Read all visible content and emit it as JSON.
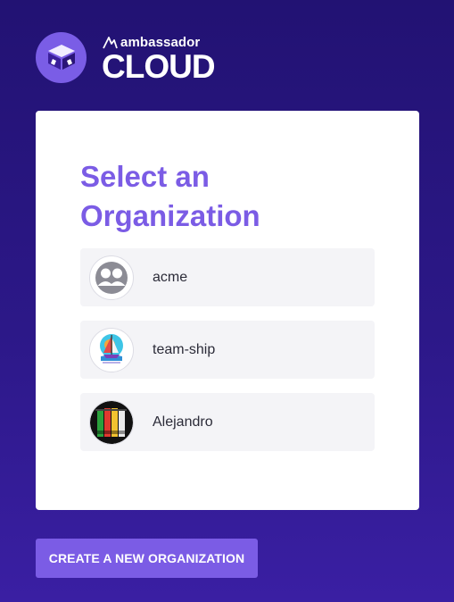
{
  "brand": {
    "small_text": "ambassador",
    "big_text": "CLOUD",
    "mark_icon": "ambassador-logo-icon",
    "accent_color": "#7b5ce5"
  },
  "card": {
    "title": "Select an Organization"
  },
  "organizations": [
    {
      "name": "acme",
      "avatar_icon": "group-icon"
    },
    {
      "name": "team-ship",
      "avatar_icon": "sailboat-icon"
    },
    {
      "name": "Alejandro",
      "avatar_icon": "gate-icon"
    }
  ],
  "actions": {
    "create_label": "CREATE A NEW ORGANIZATION"
  }
}
